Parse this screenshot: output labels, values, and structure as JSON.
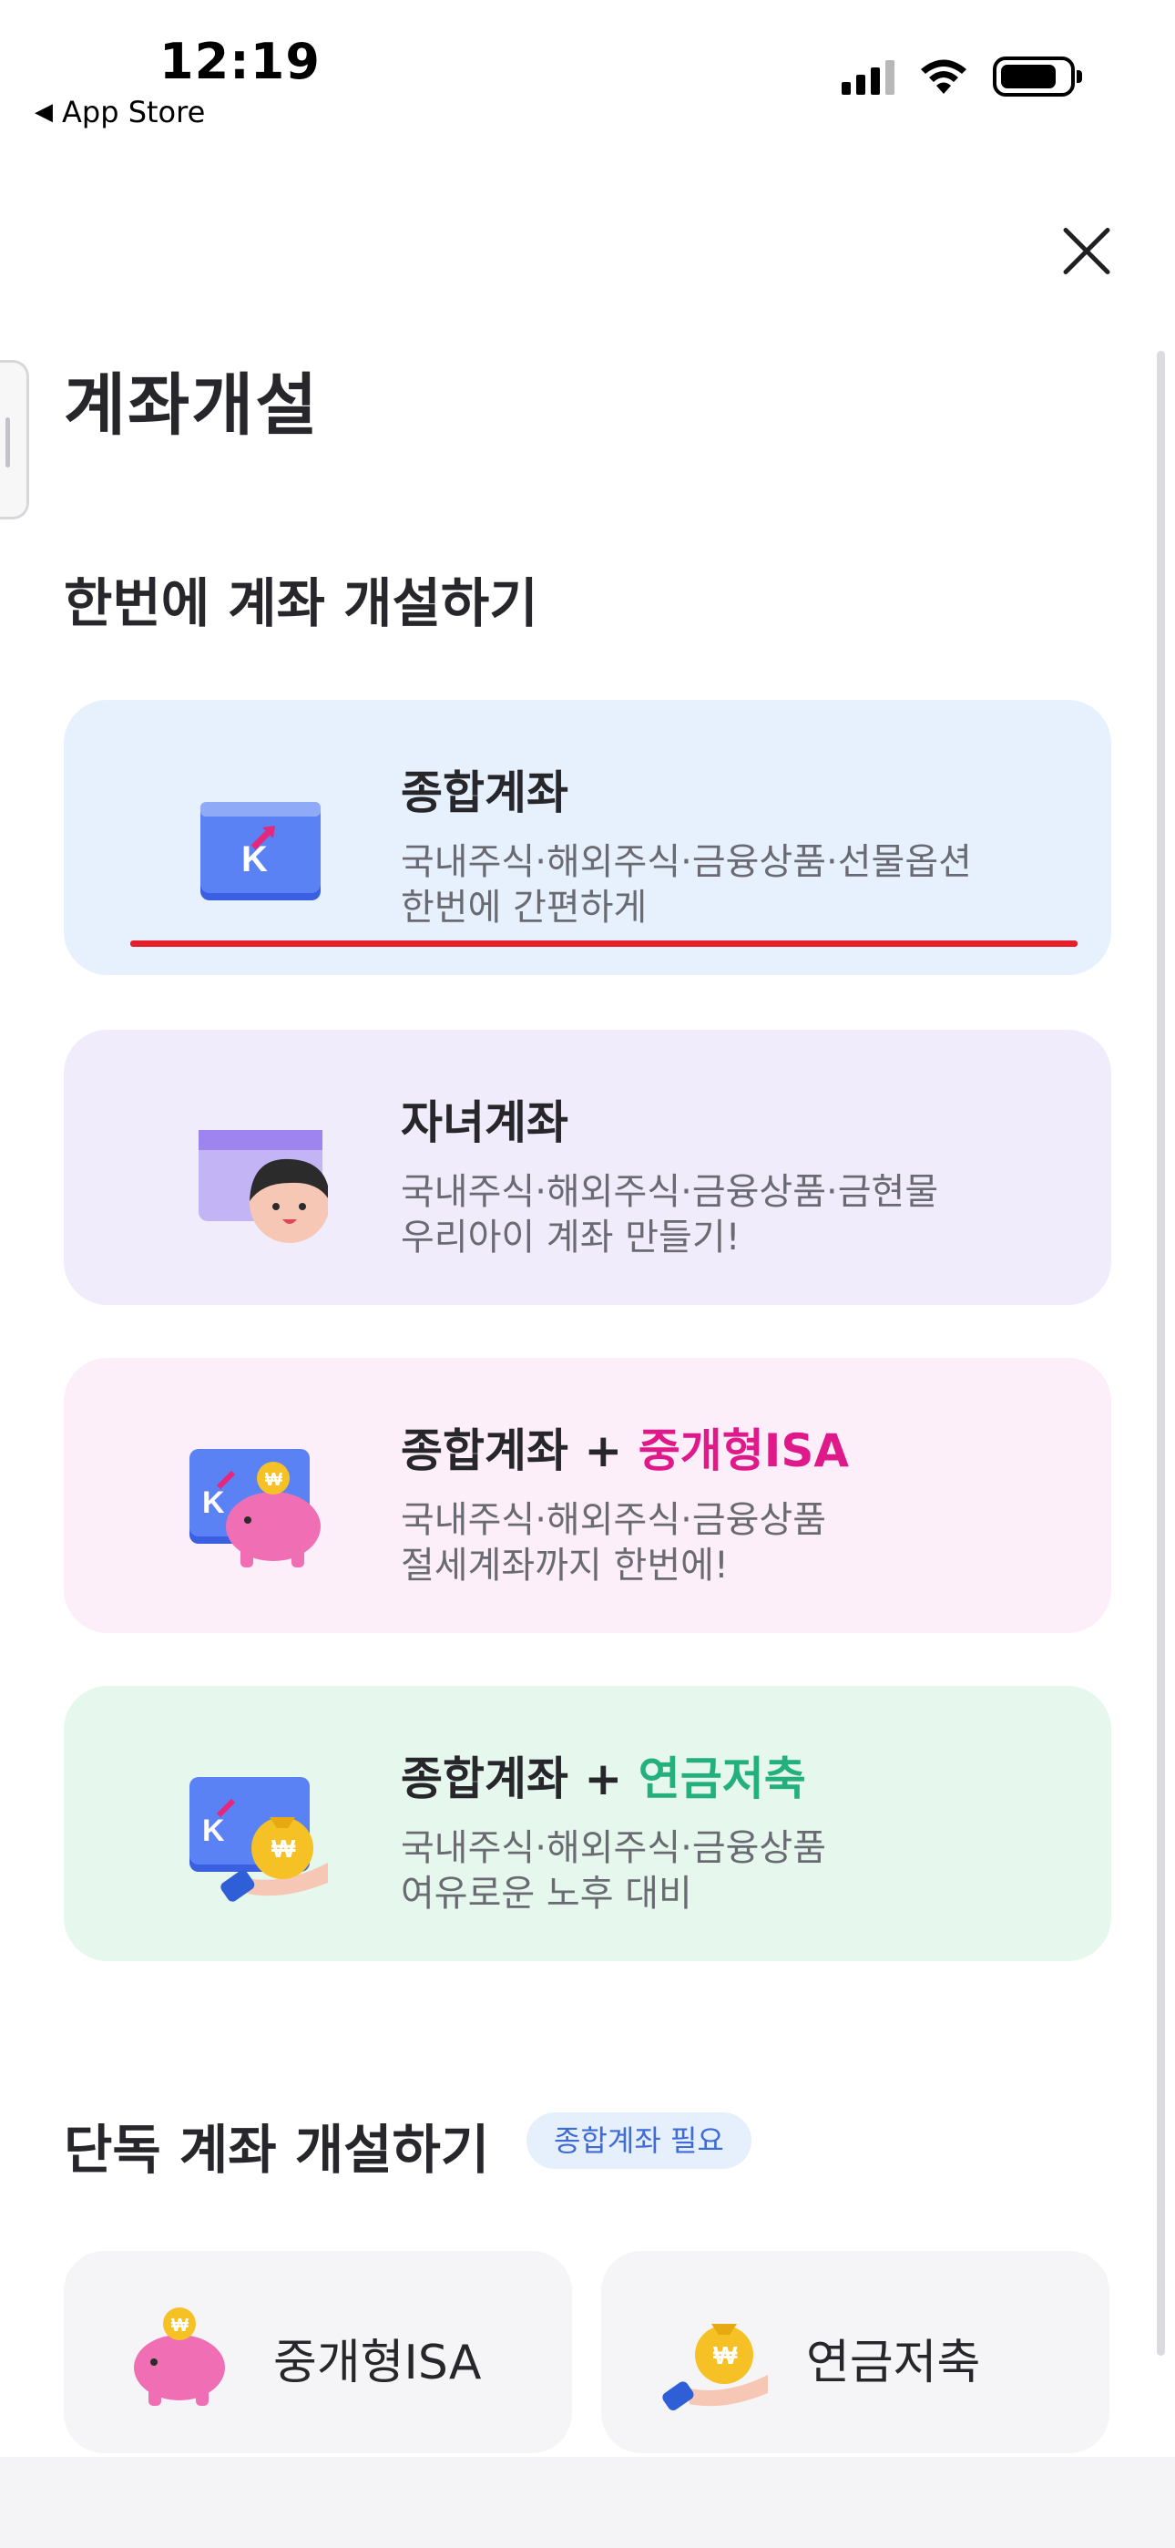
{
  "status_bar": {
    "time": "12:19",
    "back_app": "App Store"
  },
  "header": {
    "title": "계좌개설"
  },
  "sections": {
    "bundle_title": "한번에 계좌 개설하기",
    "single_title": "단독 계좌 개설하기",
    "single_badge": "종합계좌 필요"
  },
  "cards": [
    {
      "title": "종합계좌",
      "line1": "국내주식·해외주식·금융상품·선물옵션",
      "line2": "한번에 간편하게"
    },
    {
      "title": "자녀계좌",
      "line1": "국내주식·해외주식·금융상품·금현물",
      "line2": "우리아이 계좌 만들기!"
    },
    {
      "title_prefix": "종합계좌 + ",
      "title_accent": "중개형ISA",
      "line1": "국내주식·해외주식·금융상품",
      "line2": "절세계좌까지 한번에!"
    },
    {
      "title_prefix": "종합계좌 + ",
      "title_accent": "연금저축",
      "line1": "국내주식·해외주식·금융상품",
      "line2": "여유로운 노후 대비"
    }
  ],
  "single_accounts": [
    {
      "label": "중개형ISA"
    },
    {
      "label": "연금저축"
    }
  ],
  "colors": {
    "accent_pink": "#e0198a",
    "accent_green": "#23b07e",
    "card_blue_bg": "#e7f1fd",
    "card_purple_bg": "#f1ecfb",
    "card_pink_bg": "#fdeff9",
    "card_green_bg": "#e6f8ee",
    "highlight_underline": "#e61e2b"
  },
  "icons": {
    "back": "back-triangle-icon",
    "signal": "cellular-signal-icon",
    "wifi": "wifi-icon",
    "battery": "battery-icon",
    "close": "close-icon",
    "card1": "k-card-icon",
    "card2": "child-card-icon",
    "card3": "k-card-piggy-icon",
    "card4": "k-card-moneybag-icon",
    "single1": "piggy-bank-icon",
    "single2": "money-bag-hand-icon"
  }
}
